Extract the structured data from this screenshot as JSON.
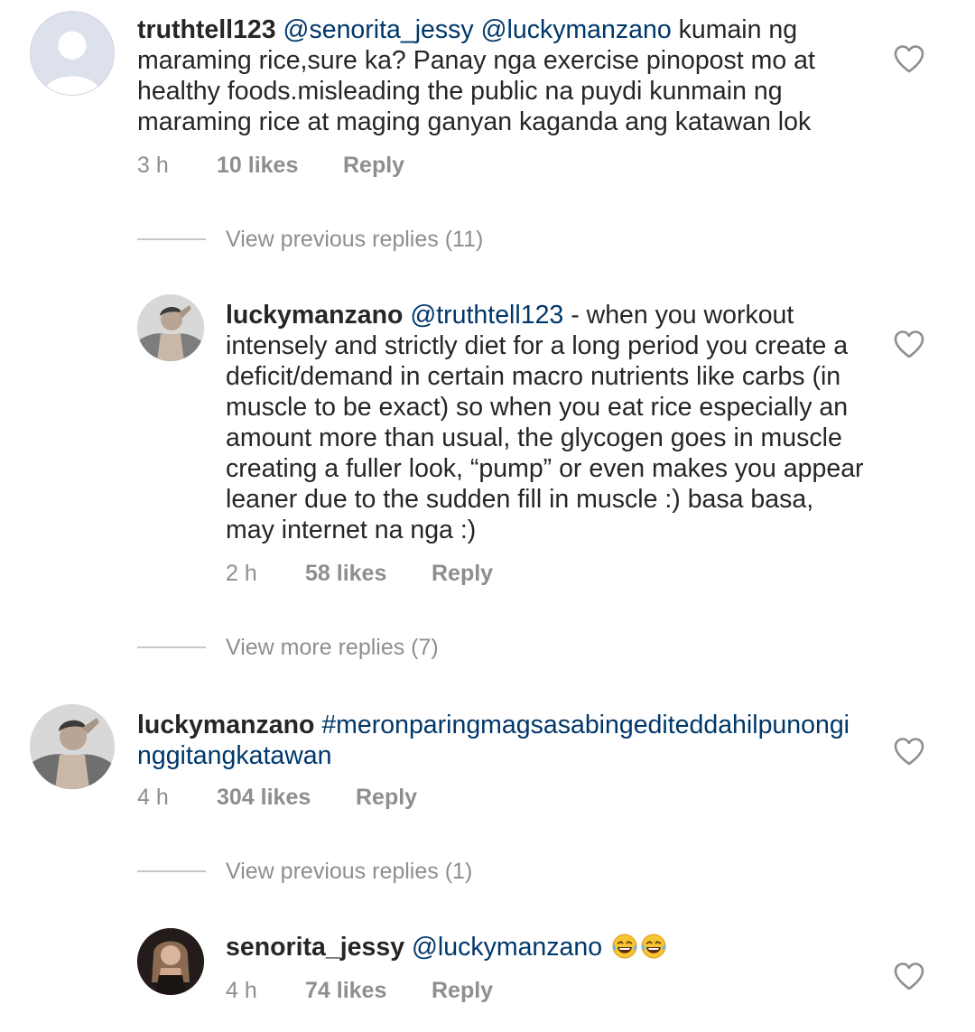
{
  "comments": [
    {
      "username": "truthtell123",
      "mentions": [
        "@senorita_jessy",
        "@luckymanzano"
      ],
      "body": "kumain ng maraming rice,sure ka? Panay nga exercise pinopost mo at healthy foods.misleading the public na puydi kunmain ng maraming rice at maging ganyan kaganda ang katawan lok",
      "time": "3 h",
      "likes": "10 likes",
      "reply": "Reply",
      "avatar": "default-avatar"
    },
    {
      "username": "luckymanzano",
      "mentions": [
        "@truthtell123"
      ],
      "body": "- when you workout intensely and strictly diet for a long period you create a deficit/demand in certain macro nutrients like carbs (in muscle to be exact) so when you eat rice  especially an amount more than usual, the glycogen goes in muscle creating a fuller look, “pump” or even makes you appear leaner due to the sudden fill in muscle :) basa basa, may internet na nga :)",
      "time": "2 h",
      "likes": "58 likes",
      "reply": "Reply",
      "avatar": "profile-photo-man"
    },
    {
      "username": "luckymanzano",
      "hashtag": "#meronparingmagsasabingediteddahilpunongi nggitangkatawan",
      "time": "4 h",
      "likes": "304 likes",
      "reply": "Reply",
      "avatar": "profile-photo-man"
    },
    {
      "username": "senorita_jessy",
      "mentions": [
        "@luckymanzano"
      ],
      "emojis": [
        "😂",
        "😂"
      ],
      "time": "4 h",
      "likes": "74 likes",
      "reply": "Reply",
      "avatar": "profile-photo-woman"
    }
  ],
  "view_replies": [
    "View previous replies (11)",
    "View more replies (7)",
    "View previous replies (1)"
  ],
  "icons": {
    "like": "heart-outline-icon",
    "emoji": "face-with-tears-of-joy"
  },
  "colors": {
    "text": "#262626",
    "link": "#00376b",
    "muted": "#8e8e8e",
    "divider": "#c7c7c7",
    "background": "#ffffff"
  }
}
